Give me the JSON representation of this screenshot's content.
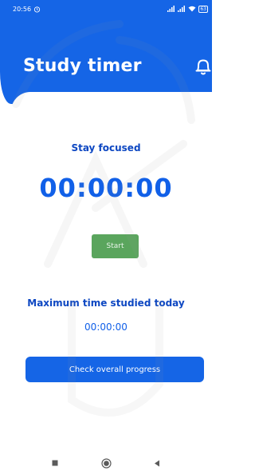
{
  "status_bar": {
    "time": "20:56",
    "battery": "63"
  },
  "header": {
    "title": "Study timer"
  },
  "timer": {
    "focus_label": "Stay focused",
    "value": "00:00:00",
    "start_label": "Start"
  },
  "stats": {
    "max_label": "Maximum time studied today",
    "max_value": "00:00:00"
  },
  "actions": {
    "progress_label": "Check overall progress"
  },
  "colors": {
    "primary": "#1565e6",
    "start_button": "#5aa55d",
    "text_dark_blue": "#0d47c2"
  },
  "icons": {
    "header": "bell-icon",
    "nav": [
      "recent-apps-icon",
      "home-icon",
      "back-icon"
    ]
  }
}
